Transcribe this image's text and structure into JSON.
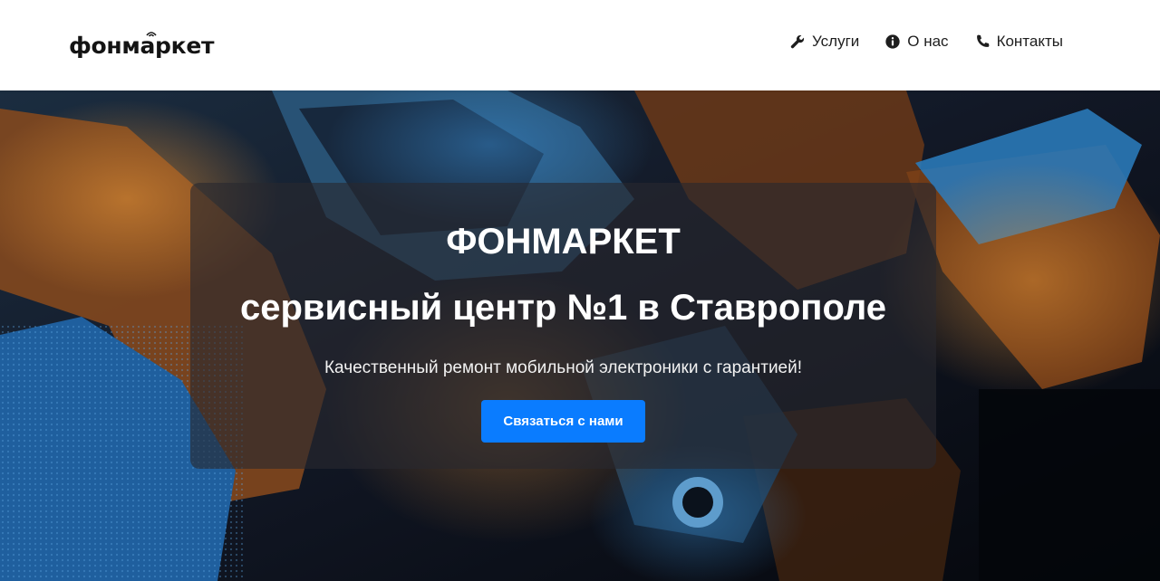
{
  "header": {
    "logo_text": "фонмаркет",
    "nav": [
      {
        "label": "Услуги",
        "icon": "wrench-icon"
      },
      {
        "label": "О нас",
        "icon": "info-icon"
      },
      {
        "label": "Контакты",
        "icon": "phone-icon"
      }
    ]
  },
  "hero": {
    "title": "ФОНМАРКЕТ",
    "subtitle": "сервисный центр №1 в Ставрополе",
    "tagline": "Качественный ремонт мобильной электроники с гарантией!",
    "cta_label": "Связаться с нами",
    "background": "circuit-board-photo"
  },
  "colors": {
    "accent": "#0a7cff",
    "header_bg": "#ffffff",
    "card_bg": "rgba(40,40,46,0.62)"
  }
}
